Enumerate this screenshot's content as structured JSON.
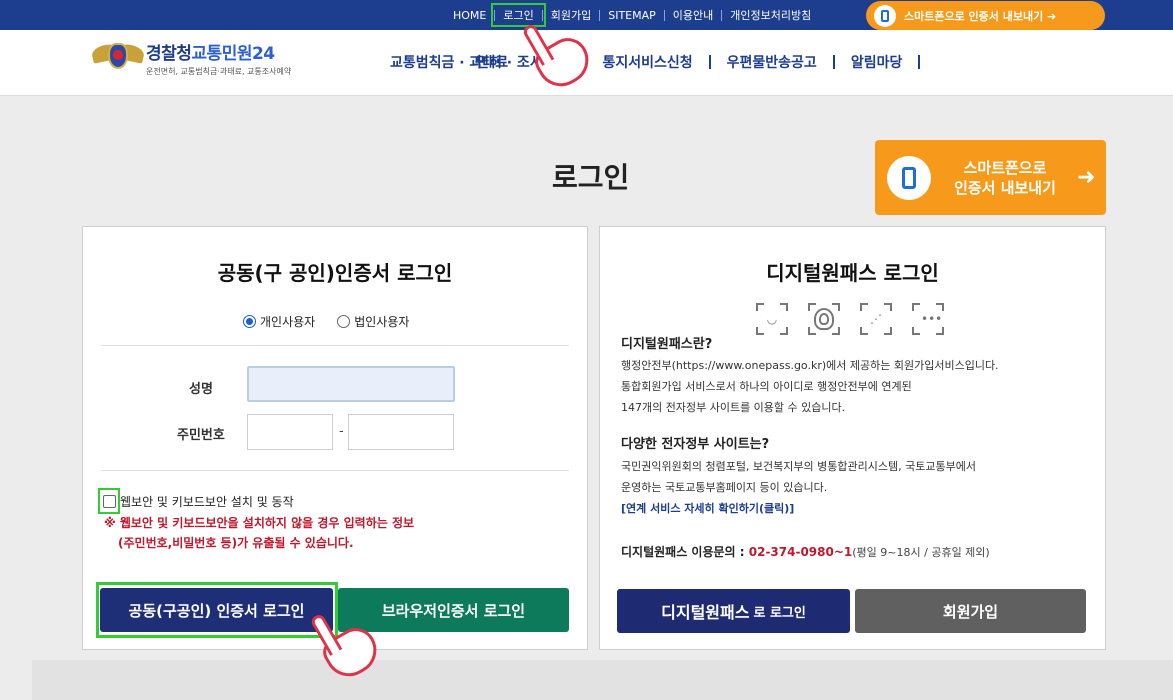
{
  "topnav": {
    "items": [
      "HOME",
      "로그인",
      "회원가입",
      "SITEMAP",
      "이용안내",
      "개인정보처리방침"
    ],
    "smart_export": "스마트폰으로 인증서 내보내기 ➜"
  },
  "header": {
    "logo_prefix": "경찰청",
    "logo_suffix": "교통민원24",
    "logo_sub": "운전면허, 교통범칙금·과태료, 교통조사예약",
    "gnb": [
      "교통범칙금 · 과태료",
      "면허 · 조사예약",
      "통지서비스신청",
      "우편물반송공고",
      "알림마당"
    ]
  },
  "page": {
    "title": "로그인",
    "export_line1": "스마트폰으로",
    "export_line2": "인증서 내보내기",
    "export_arrow": "➜"
  },
  "left_panel": {
    "title": "공동(구 공인)인증서 로그인",
    "radio_personal": "개인사용자",
    "radio_corp": "법인사용자",
    "name_label": "성명",
    "rrn_label": "주민번호",
    "rrn_dash": "-",
    "checkbox_label": "웹보안 및 키보드보안 설치 및 동작",
    "warning_line1": "※ 웹보안 및 키보드보안을 설치하지 않을 경우 입력하는 정보",
    "warning_line2": "(주민번호,비밀번호 등)가 유출될 수 있습니다.",
    "cert_login_button": "공동(구공인) 인증서 로그인",
    "browser_login_button": "브라우저인증서 로그인"
  },
  "right_panel": {
    "title": "디지털원패스 로그인",
    "icons": [
      "face-scan-icon",
      "fingerprint-icon",
      "pattern-icon",
      "pin-icon"
    ],
    "what_heading": "디지털원패스란?",
    "what_line1": "행정안전부(https://www.onepass.go.kr)에서 제공하는 회원가입서비스입니다.",
    "what_line2": "통합회원가입 서비스로서 하나의 아이디로 행정안전부에 연계된",
    "what_line3": "147개의 전자정부 사이트를 이용할 수 있습니다.",
    "sites_heading": "다양한 전자정부 사이트는?",
    "sites_line1": "국민권익위원회의 청렴포털, 보건복지부의 병통합관리시스템, 국토교통부에서",
    "sites_line2": "운영하는 국토교통부홈페이지 등이 있습니다.",
    "link": "[연계 서비스 자세히 확인하기(클릭)]",
    "contact_label": "디지털원패스 이용문의 :",
    "contact_phone": "02-374-0980~1",
    "contact_hours": "(평일 9~18시 / 공휴일 제외)",
    "onepass_button_main": "디지털원패스",
    "onepass_button_sub": "로 로그인",
    "join_button": "회원가입"
  }
}
